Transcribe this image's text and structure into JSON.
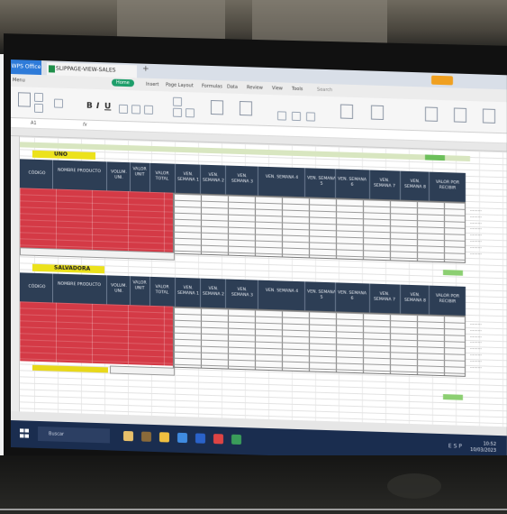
{
  "app": {
    "tab_brand": "WPS Office",
    "doc_tab": "SLIPPAGE-VIEW-SALES",
    "tab_plus": "+",
    "menu": [
      "Menu",
      "Home",
      "Insert",
      "Page Layout",
      "Formulas",
      "Data",
      "Review",
      "View",
      "Tools"
    ],
    "menu_search": "Search",
    "formula_cell": "A1",
    "formula_fx": "fx"
  },
  "sections": [
    {
      "label": "UNO",
      "headers": [
        "CÓDIGO",
        "NOMBRE PRODUCTO",
        "VOLUM. UNI.",
        "VALOR UNIT",
        "VALOR TOTAL",
        "VEN. SEMANA 1",
        "VEN. SEMANA 2",
        "VEN. SEMANA 3",
        "VEN. SEMANA 4",
        "VEN. SEMANA 5",
        "VEN. SEMANA 6",
        "VEN. SEMANA 7",
        "VEN. SEMANA 8",
        "VALOR POR RECIBIR"
      ]
    },
    {
      "label": "SALVADORA",
      "headers": [
        "CÓDIGO",
        "NOMBRE PRODUCTO",
        "VOLUM. UNI.",
        "VALOR UNIT",
        "VALOR TOTAL",
        "VEN. SEMANA 1",
        "VEN. SEMANA 2",
        "VEN. SEMANA 3",
        "VEN. SEMANA 4",
        "VEN. SEMANA 5",
        "VEN. SEMANA 6",
        "VEN. SEMANA 7",
        "VEN. SEMANA 8",
        "VALOR POR RECIBIR"
      ]
    }
  ],
  "taskbar": {
    "search": "Buscar",
    "systray": "ESP",
    "time": "10:52",
    "date": "10/03/2023"
  },
  "colors": {
    "header_navy": "#2d3e55",
    "data_red": "#d43a46",
    "label_yellow": "#ece21c",
    "total_green": "#8ccf72",
    "taskbar": "#1a2d4f"
  }
}
